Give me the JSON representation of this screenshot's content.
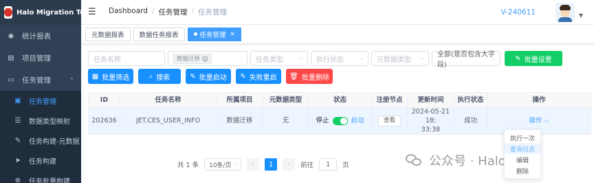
{
  "app": {
    "title": "Halo Migration Tool"
  },
  "sidebar": {
    "items": [
      {
        "label": "统计报表",
        "icon": "dashboard-icon"
      },
      {
        "label": "项目管理",
        "icon": "project-icon"
      },
      {
        "label": "任务管理",
        "icon": "monitor-icon",
        "expanded": true
      }
    ],
    "subitems": [
      {
        "label": "任务管理",
        "icon": "file-icon",
        "active": true
      },
      {
        "label": "数据类型映射",
        "icon": "list-icon"
      },
      {
        "label": "任务构建-元数据",
        "icon": "edit-icon"
      },
      {
        "label": "任务构建",
        "icon": "send-icon"
      },
      {
        "label": "任务批量构建",
        "icon": "globe-icon"
      }
    ]
  },
  "navbar": {
    "breadcrumb": [
      "Dashboard",
      "任务管理",
      "任务管理"
    ],
    "version": "V-240611"
  },
  "tabs": [
    {
      "label": "元数据报表",
      "active": false
    },
    {
      "label": "数据任务报表",
      "active": false
    },
    {
      "label": "任务管理",
      "active": true
    }
  ],
  "filters": {
    "task_name_placeholder": "任务名称",
    "project_chip": "数据迁移",
    "task_type_placeholder": "任务类型",
    "exec_status_placeholder": "执行状态",
    "meta_type_placeholder": "元数据类型",
    "match_mode": "全部(是否包含大字段)",
    "batch_settings_label": "批量设置"
  },
  "actions": {
    "batch_filter": "批量筛选",
    "search": "搜索",
    "batch_start": "批量启动",
    "fail_restart": "失败重启",
    "batch_delete": "批量删除"
  },
  "table": {
    "headers": [
      "ID",
      "任务名称",
      "所属项目",
      "元数据类型",
      "状态",
      "注册节点",
      "更新时间",
      "执行状态",
      "操作"
    ],
    "rows": [
      {
        "id": "202636",
        "name": "JET.CES_USER_INFO",
        "project": "数据迁移",
        "meta_type": "无",
        "status_off": "停止",
        "status_on": "启动",
        "node_button": "查看",
        "updated_line1": "2024-05-21 18:",
        "updated_line2": "33:38",
        "exec_status": "成功",
        "op_label": "操作"
      }
    ]
  },
  "dropdown": {
    "items": [
      "执行一次",
      "查询日志",
      "编辑",
      "删除"
    ]
  },
  "pagination": {
    "total": "共 1 条",
    "page_size": "10条/页",
    "current": "1",
    "goto_prefix": "前往",
    "goto_value": "1",
    "goto_suffix": "页"
  },
  "watermark": {
    "text": "公众号 · Halo Tech"
  },
  "colors": {
    "sidebar_bg": "#304156",
    "primary": "#1890ff",
    "success": "#13ce66",
    "danger": "#ff4949"
  }
}
